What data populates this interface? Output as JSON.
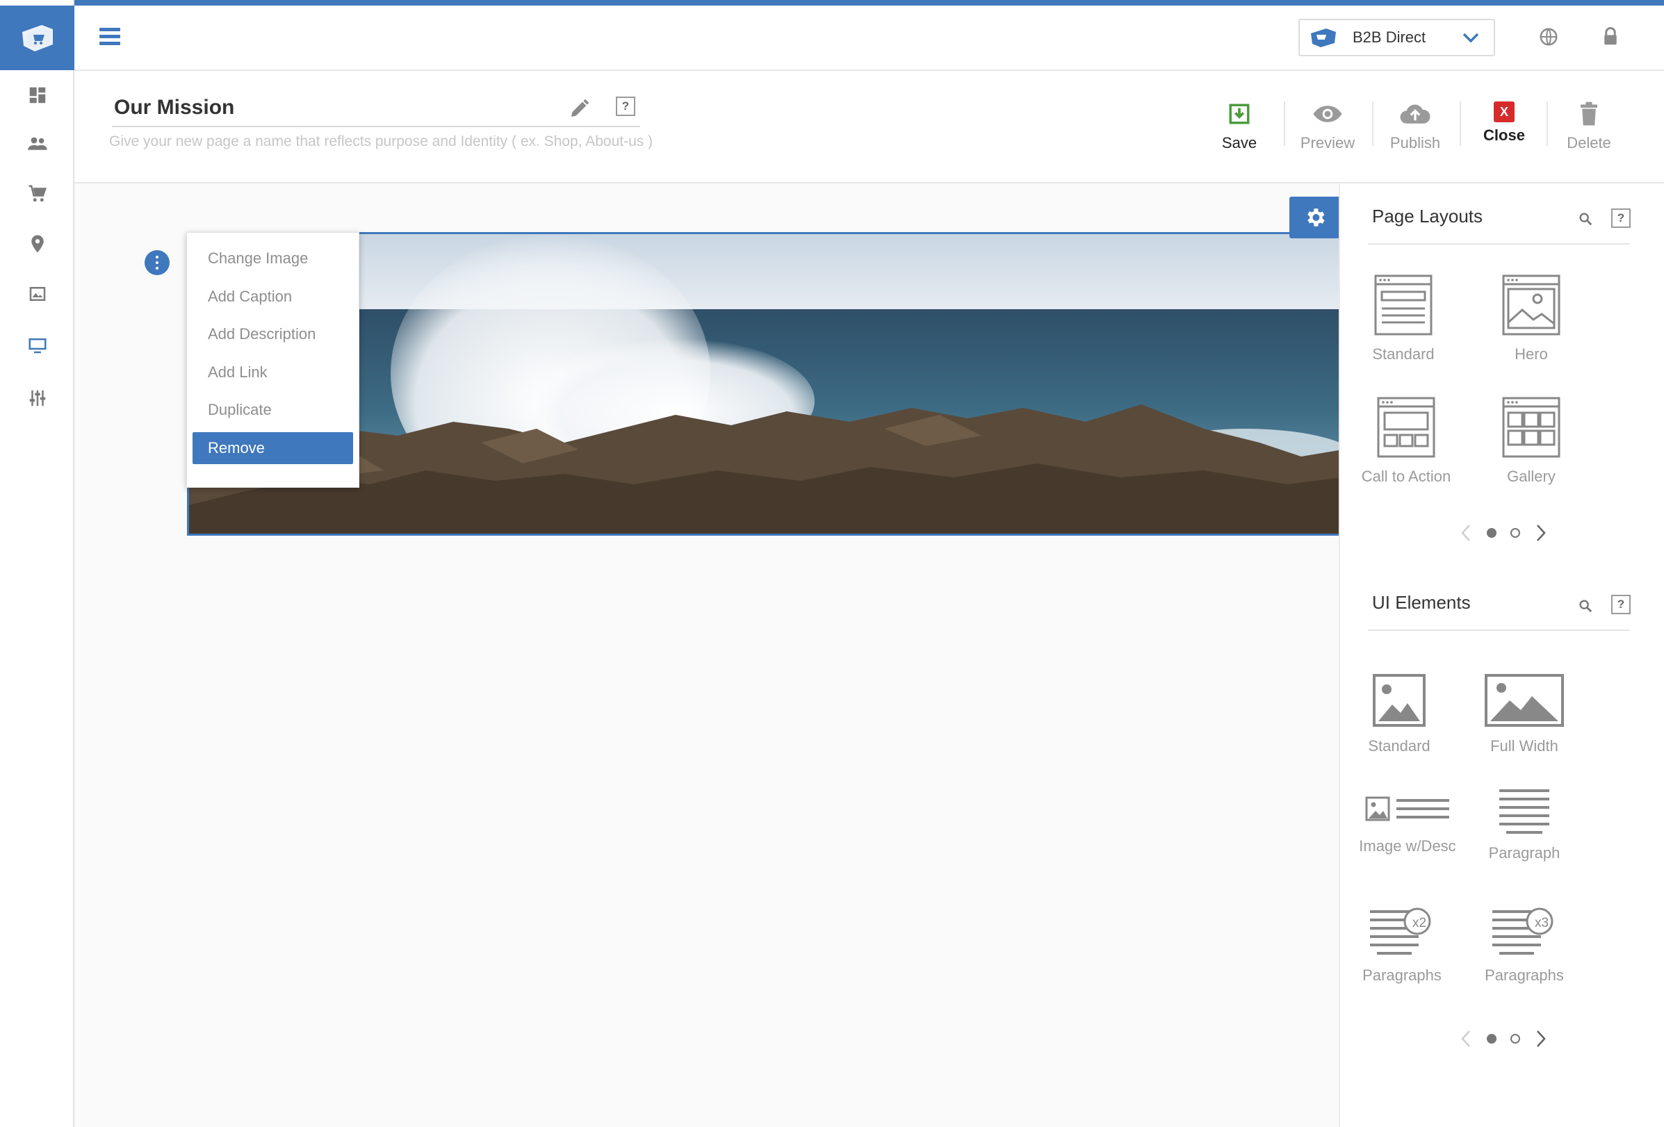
{
  "header": {
    "store_name": "B2B Direct"
  },
  "page": {
    "title": "Our Mission",
    "title_hint": "Give your new page a name that reflects purpose and Identity ( ex. Shop, About-us )",
    "help": "?"
  },
  "actions": {
    "save": "Save",
    "preview": "Preview",
    "publish": "Publish",
    "close": "Close",
    "close_badge": "X",
    "delete": "Delete"
  },
  "context_menu": {
    "items": [
      "Change Image",
      "Add Caption",
      "Add Description",
      "Add Link",
      "Duplicate",
      "Remove"
    ]
  },
  "page_layouts": {
    "title": "Page Layouts",
    "help": "?",
    "tiles": [
      "Standard",
      "Hero",
      "Call to Action",
      "Gallery"
    ]
  },
  "ui_elements": {
    "title": "UI Elements",
    "help": "?",
    "tiles": [
      "Standard",
      "Full Width",
      "Image w/Desc",
      "Paragraph",
      "Paragraphs",
      "Paragraphs"
    ],
    "badges": [
      "x2",
      "x3"
    ]
  },
  "colors": {
    "accent": "#3f78bd",
    "save_green": "#4a9a3a",
    "close_red": "#d62b2b"
  },
  "icons": {
    "rail": [
      "dashboard-icon",
      "people-icon",
      "cart-icon",
      "location-pin-icon",
      "image-icon",
      "desktop-icon",
      "sliders-icon"
    ],
    "header": [
      "hamburger-menu-icon",
      "store-tag-icon",
      "chevron-down-icon",
      "globe-icon",
      "lock-icon"
    ]
  }
}
